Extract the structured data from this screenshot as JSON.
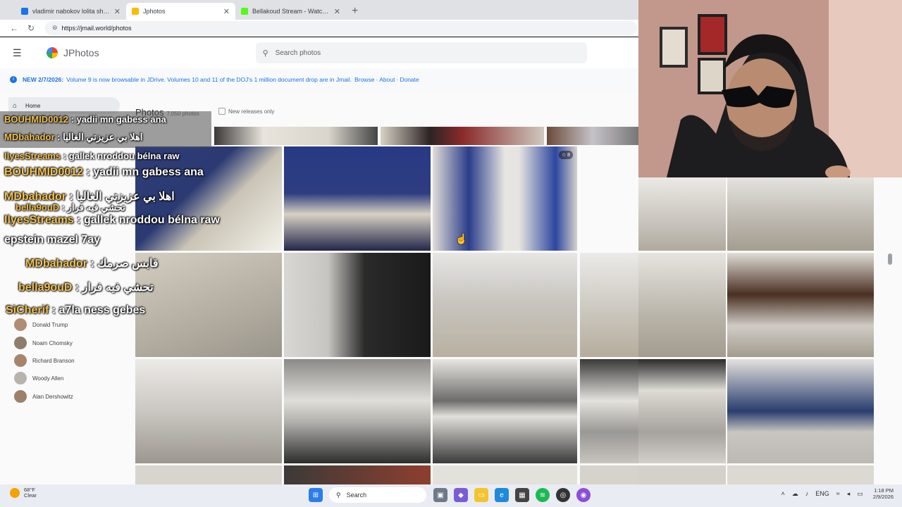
{
  "browser": {
    "tabs": [
      {
        "label": "vladimir nabokov lolita she was lo",
        "favicon_color": "#1a73e8",
        "active": false
      },
      {
        "label": "Jphotos",
        "favicon_color": "#fbbc05",
        "active": true
      },
      {
        "label": "Bellakoud Stream - Watch Live on",
        "favicon_color": "#53fc18",
        "active": false
      }
    ],
    "new_tab": "+",
    "url": "https://jmail.world/photos"
  },
  "app": {
    "title": "JPhotos",
    "search_placeholder": "Search photos",
    "banner": {
      "date": "NEW 2/7/2026:",
      "text": "Volume 9 is now browsable in JDrive. Volumes 10 and 11 of the DOJ's 1 million document drop are in Jmail.",
      "browse": "Browse",
      "about": "About",
      "donate": "Donate",
      "dot": "·"
    },
    "sidebar": {
      "home": "Home",
      "people": [
        "Donald Trump",
        "Noam Chomsky",
        "Richard Branson",
        "Woody Allen",
        "Alan Dershowitz"
      ]
    },
    "photos": {
      "title": "Photos",
      "count": "7,050 photos",
      "new_only": "New releases only",
      "star_badge": "☆ 8"
    }
  },
  "chat": [
    {
      "user": "BOUHMID0012",
      "text": " : yadii mn gabess ana",
      "size": "small"
    },
    {
      "user": "MDbahador",
      "text": " : اهلا بي عزيزتي الغاليا",
      "size": "small"
    },
    {
      "user": "IlyesStreams",
      "text": " : gallek nroddou bélna raw",
      "size": "small"
    },
    {
      "user": "BOUHMID0012",
      "text": " : yadii mn gabess ana",
      "size": "big"
    },
    {
      "user": "MDbahador",
      "text": " : اهلا بي عزيزتي الغاليا",
      "size": "big"
    },
    {
      "user": "bella9ouD",
      "text": " : تحشي فيه فرار",
      "size": "small"
    },
    {
      "user": "IlyesStreams",
      "text": " : gallek nroddou bélna raw",
      "size": "big"
    },
    {
      "user": "",
      "text": "epstein mazel 7ay",
      "size": "big"
    },
    {
      "user": "MDbahador",
      "text": " : قابس صرمك",
      "size": "big"
    },
    {
      "user": "bella9ouD",
      "text": " : تحشي فيه فرار",
      "size": "big"
    },
    {
      "user": "SiCherif",
      "text": " : a7la ness gebes",
      "size": "big"
    }
  ],
  "taskbar": {
    "weather_temp": "68°F",
    "weather_desc": "Clear",
    "search": "Search",
    "lang": "ENG",
    "time": "1:18 PM",
    "date": "2/9/2026"
  },
  "colors": {
    "accent": "#1a73e8",
    "chat_user": "#f2c14e"
  }
}
